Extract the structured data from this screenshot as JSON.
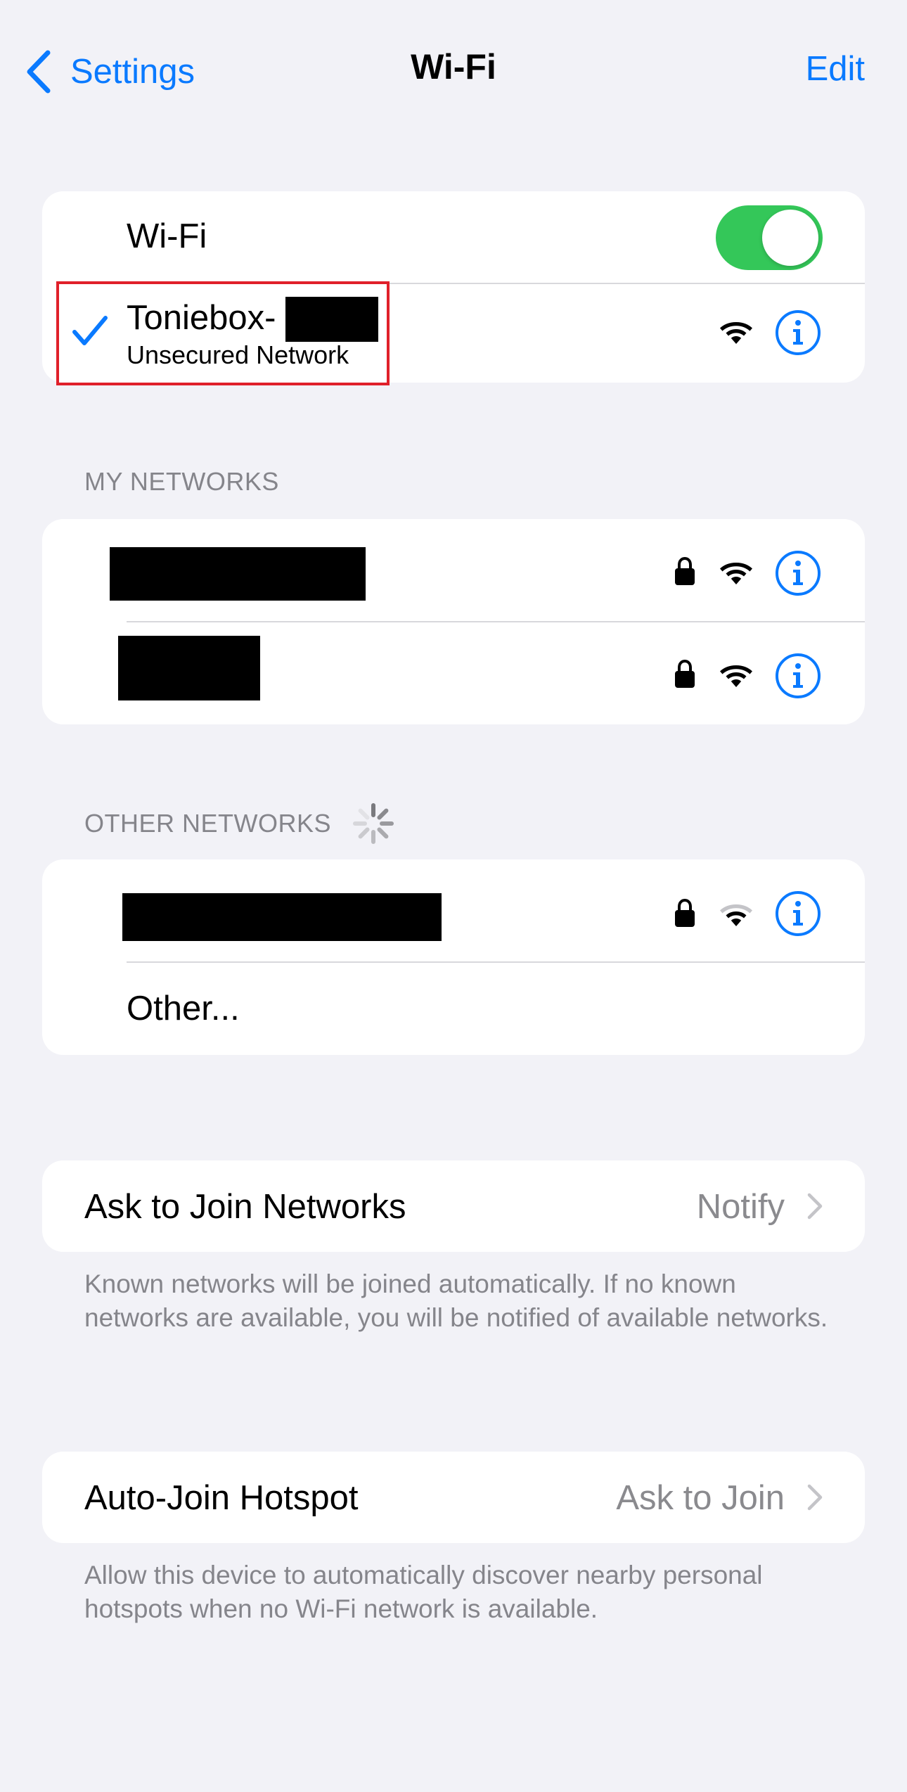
{
  "nav": {
    "back_label": "Settings",
    "title": "Wi-Fi",
    "edit_label": "Edit"
  },
  "wifi_toggle": {
    "label": "Wi-Fi",
    "on": true
  },
  "connected": {
    "name": "Toniebox-",
    "subtitle": "Unsecured Network"
  },
  "my_networks": {
    "header": "MY NETWORKS"
  },
  "other_networks": {
    "header": "OTHER NETWORKS",
    "other_label": "Other..."
  },
  "ask_to_join": {
    "label": "Ask to Join Networks",
    "value": "Notify",
    "footnote": "Known networks will be joined automatically. If no known networks are available, you will be notified of available networks."
  },
  "auto_join": {
    "label": "Auto-Join Hotspot",
    "value": "Ask to Join",
    "footnote": "Allow this device to automatically discover nearby personal hotspots when no Wi-Fi network is available."
  },
  "colors": {
    "accent": "#0a7aff",
    "toggle_on": "#34c759",
    "highlight": "#e0202a"
  }
}
